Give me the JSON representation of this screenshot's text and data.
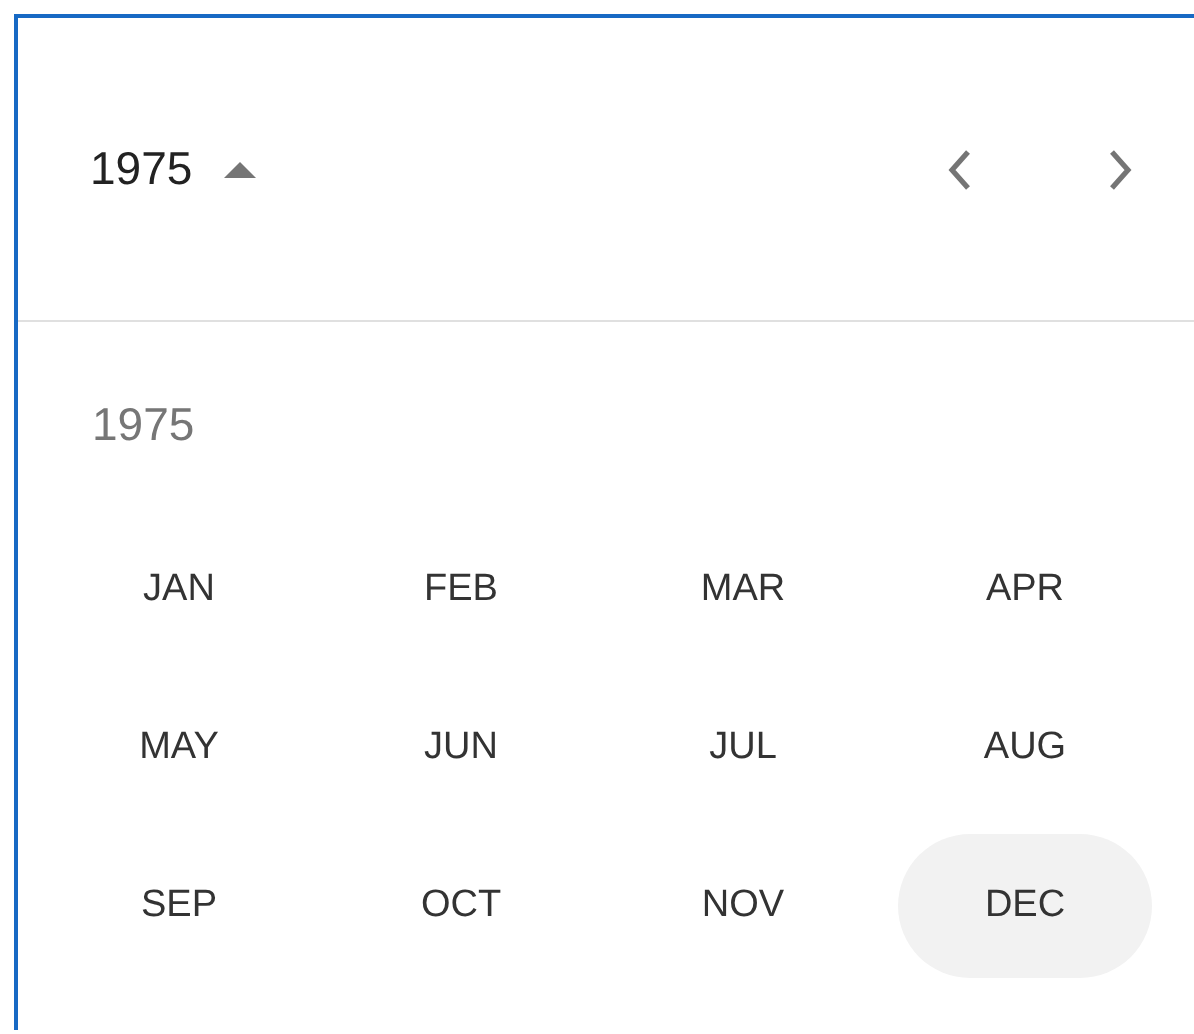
{
  "header": {
    "year": "1975",
    "year_menu_expanded": true
  },
  "year_label": "1975",
  "months": [
    {
      "label": "JAN",
      "highlighted": false
    },
    {
      "label": "FEB",
      "highlighted": false
    },
    {
      "label": "MAR",
      "highlighted": false
    },
    {
      "label": "APR",
      "highlighted": false
    },
    {
      "label": "MAY",
      "highlighted": false
    },
    {
      "label": "JUN",
      "highlighted": false
    },
    {
      "label": "JUL",
      "highlighted": false
    },
    {
      "label": "AUG",
      "highlighted": false
    },
    {
      "label": "SEP",
      "highlighted": false
    },
    {
      "label": "OCT",
      "highlighted": false
    },
    {
      "label": "NOV",
      "highlighted": false
    },
    {
      "label": "DEC",
      "highlighted": true
    }
  ]
}
